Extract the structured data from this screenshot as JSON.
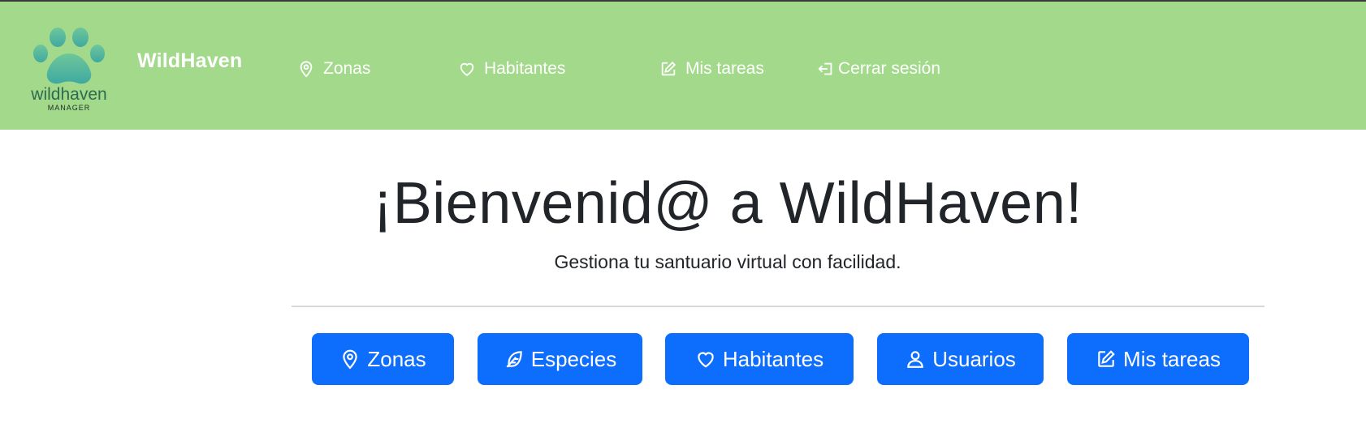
{
  "app": {
    "logo": {
      "name": "wildhaven",
      "tagline": "MANAGER"
    },
    "brand": "WildHaven"
  },
  "nav": {
    "items": [
      {
        "label": "Zonas",
        "icon": "map-pin-icon"
      },
      {
        "label": "Habitantes",
        "icon": "heart-icon"
      },
      {
        "label": "Mis tareas",
        "icon": "edit-icon"
      },
      {
        "label": "Cerrar sesión",
        "icon": "logout-icon"
      }
    ]
  },
  "hero": {
    "title": "¡Bienvenid@ a WildHaven!",
    "subtitle": "Gestiona tu santuario virtual con facilidad."
  },
  "actions": {
    "buttons": [
      {
        "label": "Zonas",
        "icon": "map-pin-icon"
      },
      {
        "label": "Especies",
        "icon": "feather-icon"
      },
      {
        "label": "Habitantes",
        "icon": "heart-icon"
      },
      {
        "label": "Usuarios",
        "icon": "user-icon"
      },
      {
        "label": "Mis tareas",
        "icon": "edit-icon"
      }
    ]
  },
  "colors": {
    "navbar": "#a2d98a",
    "primary": "#0d6efd",
    "logo_paw": "#4bb39b",
    "logo_text": "#2e6b4f"
  }
}
